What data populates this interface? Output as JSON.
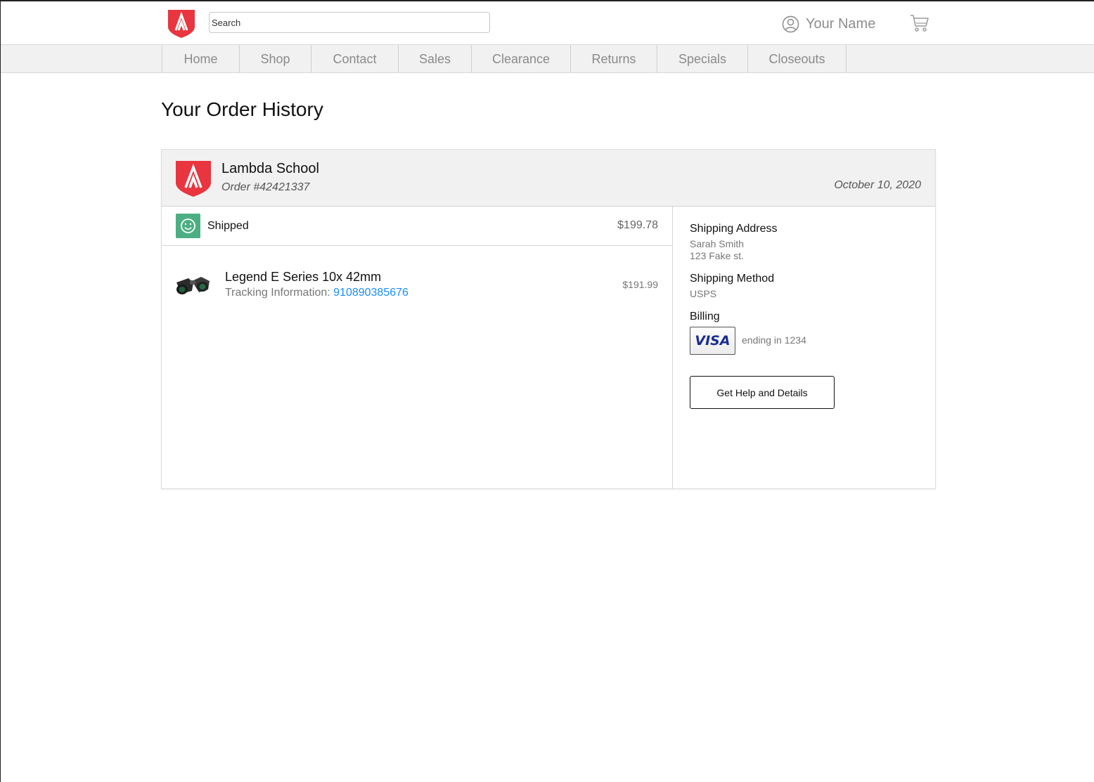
{
  "header": {
    "search_placeholder": "Search",
    "user_name": "Your Name"
  },
  "nav": {
    "items": [
      "Home",
      "Shop",
      "Contact",
      "Sales",
      "Clearance",
      "Returns",
      "Specials",
      "Closeouts"
    ]
  },
  "page": {
    "title": "Your Order History"
  },
  "order": {
    "store_name": "Lambda School",
    "order_number": "Order #42421337",
    "date": "October 10, 2020",
    "status": "Shipped",
    "total": "$199.78",
    "items": [
      {
        "name": "Legend E Series 10x 42mm",
        "tracking_label": "Tracking Information:",
        "tracking_number": "910890385676",
        "price": "$191.99"
      }
    ],
    "shipping_address": {
      "label": "Shipping Address",
      "name": "Sarah Smith",
      "street": "123 Fake st."
    },
    "shipping_method": {
      "label": "Shipping Method",
      "value": "USPS"
    },
    "billing": {
      "label": "Billing",
      "card_brand": "VISA",
      "card_ending": "ending in 1234"
    },
    "help_button_label": "Get Help and Details"
  },
  "colors": {
    "brand_red": "#e8353f",
    "status_green": "#4caf84",
    "link_blue": "#1a8cff",
    "visa_blue": "#1a2d8f"
  }
}
